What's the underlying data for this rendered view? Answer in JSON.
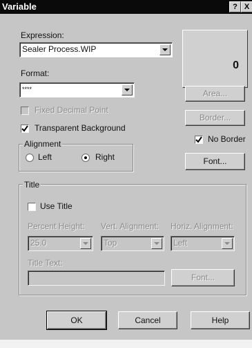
{
  "window": {
    "title": "Variable",
    "help_btn": "?",
    "close_btn": "X"
  },
  "expression": {
    "label": "Expression:",
    "value": "Sealer Process.WIP"
  },
  "preview": {
    "value": "0"
  },
  "format": {
    "label": "Format:",
    "value": "****"
  },
  "buttons": {
    "area": "Area...",
    "border": "Border...",
    "font": "Font...",
    "title_font": "Font...",
    "ok": "OK",
    "cancel": "Cancel",
    "help": "Help"
  },
  "options": {
    "fixed_decimal": "Fixed Decimal Point",
    "transparent_bg": "Transparent Background",
    "no_border": "No Border"
  },
  "alignment": {
    "legend": "Alignment",
    "left": "Left",
    "right": "Right",
    "selected": "Right"
  },
  "title_group": {
    "legend": "Title",
    "use_title": "Use Title",
    "percent_height_label": "Percent Height:",
    "percent_height_value": "25.0",
    "vert_label": "Vert. Alignment:",
    "vert_value": "Top",
    "horiz_label": "Horiz. Alignment:",
    "horiz_value": "Left",
    "title_text_label": "Title Text:",
    "title_text_value": ""
  }
}
